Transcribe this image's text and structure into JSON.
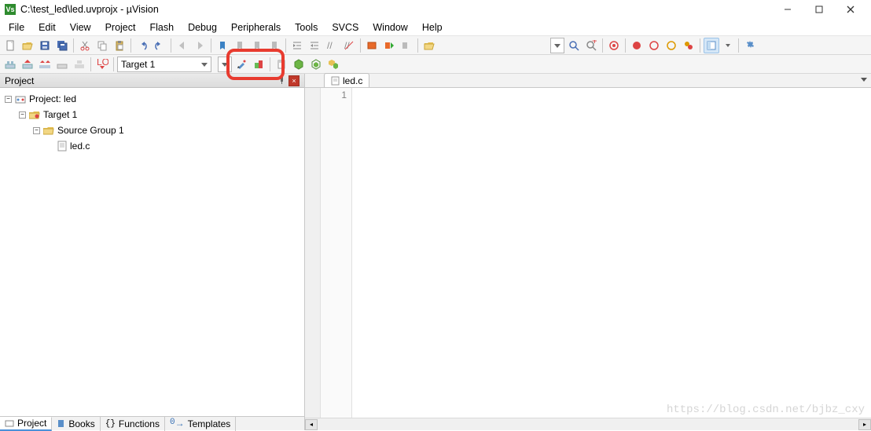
{
  "title": "C:\\test_led\\led.uvprojx - µVision",
  "menu": [
    "File",
    "Edit",
    "View",
    "Project",
    "Flash",
    "Debug",
    "Peripherals",
    "Tools",
    "SVCS",
    "Window",
    "Help"
  ],
  "toolbar2": {
    "target_combo": "Target 1"
  },
  "project_panel": {
    "header": "Project",
    "tree": {
      "root": "Project: led",
      "target": "Target 1",
      "group": "Source Group 1",
      "file": "led.c"
    },
    "tabs": [
      "Project",
      "Books",
      "Functions",
      "Templates"
    ]
  },
  "editor": {
    "tab": "led.c",
    "line_number": "1"
  },
  "watermark": "https://blog.csdn.net/bjbz_cxy"
}
